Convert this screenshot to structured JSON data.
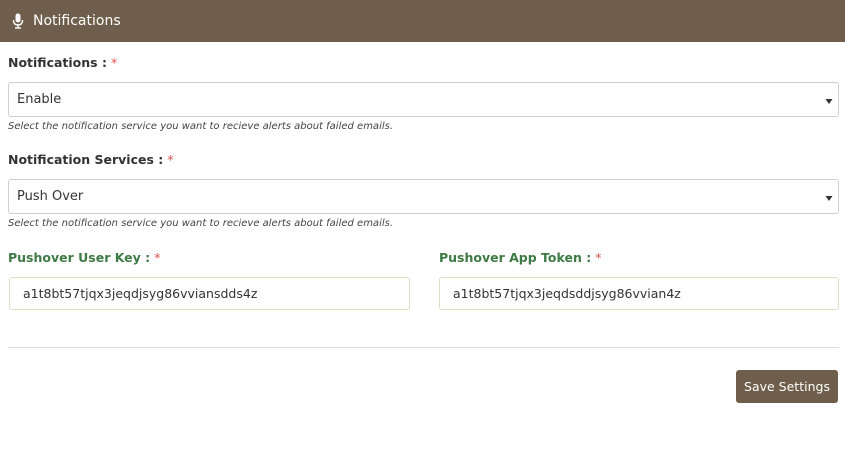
{
  "header": {
    "title": "Notifications",
    "icon": "microphone-icon"
  },
  "form": {
    "notifications": {
      "label": "Notifications :",
      "required_mark": "*",
      "value": "Enable",
      "help": "Select the notification service you want to recieve alerts about failed emails."
    },
    "notification_services": {
      "label": "Notification Services :",
      "required_mark": "*",
      "value": "Push Over",
      "help": "Select the notification service you want to recieve alerts about failed emails."
    },
    "pushover_user_key": {
      "label": "Pushover User Key :",
      "required_mark": "*",
      "value": "a1t8bt57tjqx3jeqdjsyg86vviansdds4z"
    },
    "pushover_app_token": {
      "label": "Pushover App Token :",
      "required_mark": "*",
      "value": "a1t8bt57tjqx3jeqdsddjsyg86vvian4z"
    }
  },
  "actions": {
    "save_label": "Save Settings"
  },
  "colors": {
    "header_bg": "#6f5e4b",
    "button_bg": "#6f5e4b",
    "required": "#d9534f",
    "green_label": "#3e7a45"
  }
}
